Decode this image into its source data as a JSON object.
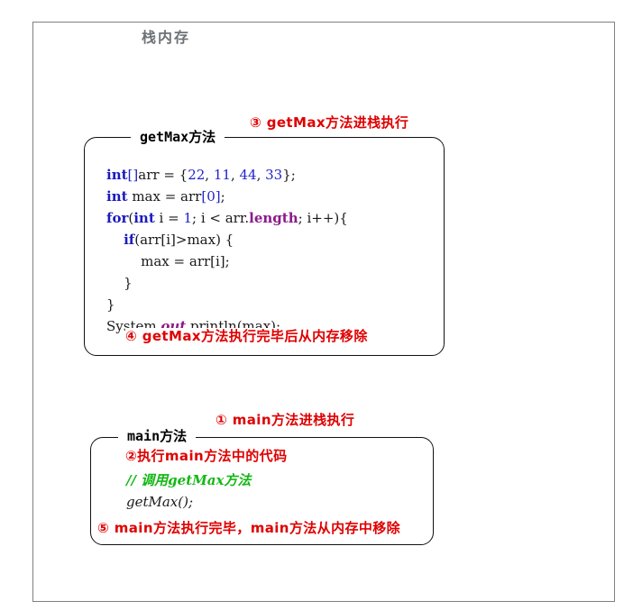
{
  "frame": {
    "title": "栈内存"
  },
  "colors": {
    "frame_border": "#7c8084",
    "frame_title": "#6d7276",
    "annotation_red": "#e00000",
    "keyword_blue": "#1b1bbd",
    "number_blue": "#2222cc",
    "field_purple": "#8b1a8b",
    "comment_green": "#14b814",
    "box_border": "#111111"
  },
  "getmax_box": {
    "legend": "getMax方法",
    "annotation_enter": "③ getMax方法进栈执行",
    "annotation_exit": "④ getMax方法执行完毕后从内存移除",
    "code_lines": [
      {
        "tokens": [
          {
            "t": "int",
            "c": "kw"
          },
          {
            "t": "[]",
            "c": "brk"
          },
          {
            "t": "arr = ",
            "c": ""
          },
          {
            "t": "{",
            "c": ""
          },
          {
            "t": "22",
            "c": "num"
          },
          {
            "t": ", ",
            "c": ""
          },
          {
            "t": "11",
            "c": "num"
          },
          {
            "t": ", ",
            "c": ""
          },
          {
            "t": "44",
            "c": "num"
          },
          {
            "t": ", ",
            "c": ""
          },
          {
            "t": "33",
            "c": "num"
          },
          {
            "t": "};",
            "c": ""
          }
        ]
      },
      {
        "tokens": [
          {
            "t": "int",
            "c": "kw"
          },
          {
            "t": " max = arr",
            "c": ""
          },
          {
            "t": "[",
            "c": "brk"
          },
          {
            "t": "0",
            "c": "num"
          },
          {
            "t": "]",
            "c": "brk"
          },
          {
            "t": ";",
            "c": ""
          }
        ]
      },
      {
        "tokens": [
          {
            "t": "for",
            "c": "kw"
          },
          {
            "t": "(",
            "c": ""
          },
          {
            "t": "int",
            "c": "kw"
          },
          {
            "t": " i = ",
            "c": ""
          },
          {
            "t": "1",
            "c": "num"
          },
          {
            "t": "; i < arr.",
            "c": ""
          },
          {
            "t": "length",
            "c": "field"
          },
          {
            "t": "; i++){",
            "c": ""
          }
        ]
      },
      {
        "tokens": [
          {
            "t": "    ",
            "c": ""
          },
          {
            "t": "if",
            "c": "kw"
          },
          {
            "t": "(arr[i]>max) {",
            "c": ""
          }
        ]
      },
      {
        "tokens": [
          {
            "t": "        max = arr[i];",
            "c": ""
          }
        ]
      },
      {
        "tokens": [
          {
            "t": "    }",
            "c": ""
          }
        ]
      },
      {
        "tokens": [
          {
            "t": "}",
            "c": ""
          }
        ]
      },
      {
        "tokens": [
          {
            "t": "System.",
            "c": ""
          },
          {
            "t": "out",
            "c": "static-f"
          },
          {
            "t": ".println(max);",
            "c": ""
          }
        ]
      }
    ]
  },
  "main_box": {
    "legend": "main方法",
    "annotation_enter": "① main方法进栈执行",
    "annotation_execute": "②执行main方法中的代码",
    "annotation_exit": "⑤ main方法执行完毕，main方法从内存中移除",
    "code_lines": [
      {
        "tokens": [
          {
            "t": "// 调用getMax方法",
            "c": "comment"
          }
        ]
      },
      {
        "tokens": [
          {
            "t": "getMax();",
            "c": "ital"
          }
        ]
      }
    ]
  }
}
